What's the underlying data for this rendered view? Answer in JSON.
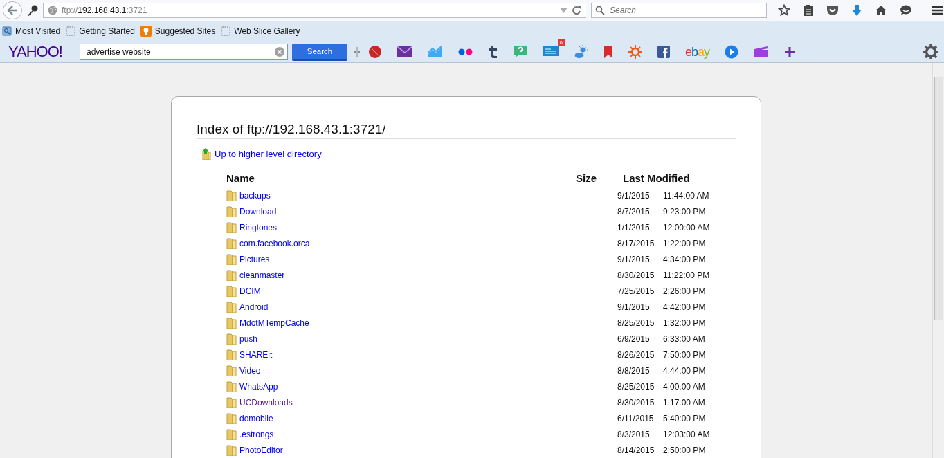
{
  "browser": {
    "url_scheme": "ftp://",
    "url_host": "192.168.43.1",
    "url_port": ":3721",
    "search_placeholder": "Search"
  },
  "bookmarks": [
    {
      "label": "Most Visited",
      "kind": "history"
    },
    {
      "label": "Getting Started",
      "kind": "slice"
    },
    {
      "label": "Suggested Sites",
      "kind": "suggested"
    },
    {
      "label": "Web Slice Gallery",
      "kind": "slice"
    }
  ],
  "yahoo_toolbar": {
    "logo": "YAHOO!",
    "query": "advertise website",
    "search_button": "Search",
    "news_badge": "6",
    "ebay_logo": "ebay"
  },
  "page": {
    "heading": "Index of ftp://192.168.43.1:3721/",
    "up_link": "Up to higher level directory",
    "columns": [
      "Name",
      "Size",
      "Last Modified"
    ],
    "rows": [
      {
        "name": "backups",
        "date": "9/1/2015",
        "time": "11:44:00 AM",
        "visited": false
      },
      {
        "name": "Download",
        "date": "8/7/2015",
        "time": "9:23:00 PM",
        "visited": false
      },
      {
        "name": "Ringtones",
        "date": "1/1/2015",
        "time": "12:00:00 AM",
        "visited": false
      },
      {
        "name": "com.facebook.orca",
        "date": "8/17/2015",
        "time": "1:22:00 PM",
        "visited": false
      },
      {
        "name": "Pictures",
        "date": "9/1/2015",
        "time": "4:34:00 PM",
        "visited": false
      },
      {
        "name": "cleanmaster",
        "date": "8/30/2015",
        "time": "11:22:00 PM",
        "visited": false
      },
      {
        "name": "DCIM",
        "date": "7/25/2015",
        "time": "2:26:00 PM",
        "visited": false
      },
      {
        "name": "Android",
        "date": "9/1/2015",
        "time": "4:42:00 PM",
        "visited": false
      },
      {
        "name": "MdotMTempCache",
        "date": "8/25/2015",
        "time": "1:32:00 PM",
        "visited": false
      },
      {
        "name": "push",
        "date": "6/9/2015",
        "time": "6:33:00 AM",
        "visited": false
      },
      {
        "name": "SHAREit",
        "date": "8/26/2015",
        "time": "7:50:00 PM",
        "visited": false
      },
      {
        "name": "Video",
        "date": "8/8/2015",
        "time": "4:44:00 PM",
        "visited": false
      },
      {
        "name": "WhatsApp",
        "date": "8/25/2015",
        "time": "4:00:00 AM",
        "visited": false
      },
      {
        "name": "UCDownloads",
        "date": "8/30/2015",
        "time": "1:17:00 AM",
        "visited": true
      },
      {
        "name": "domobile",
        "date": "6/11/2015",
        "time": "5:40:00 PM",
        "visited": false
      },
      {
        "name": ".estrongs",
        "date": "8/3/2015",
        "time": "12:03:00 AM",
        "visited": false
      },
      {
        "name": "PhotoEditor",
        "date": "8/14/2015",
        "time": "2:50:00 PM",
        "visited": false
      }
    ]
  }
}
